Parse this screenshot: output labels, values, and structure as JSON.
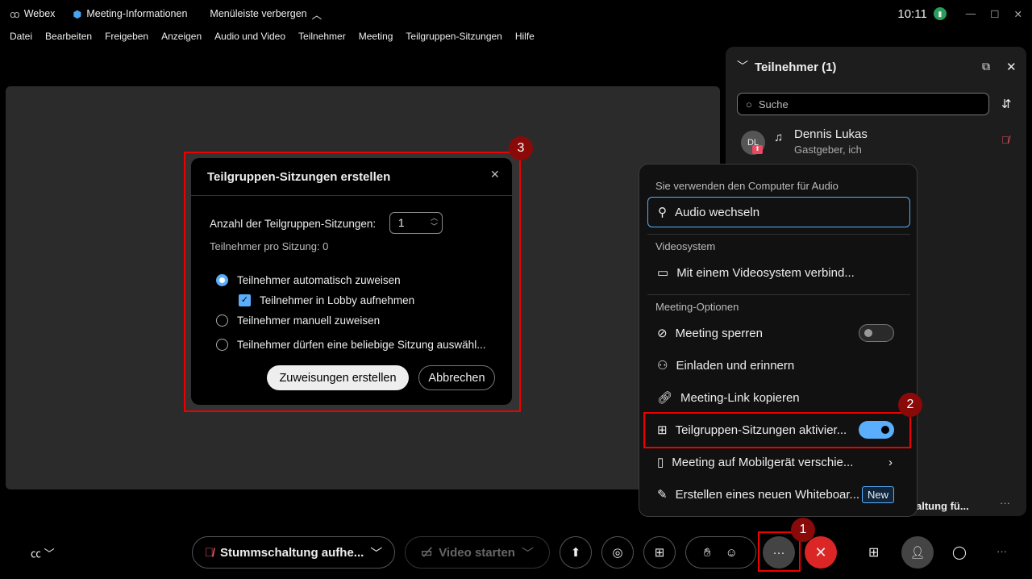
{
  "titlebar": {
    "app": "Webex",
    "meeting_info": "Meeting-Informationen",
    "hide_menu": "Menüleiste verbergen",
    "time": "10:11"
  },
  "menu": [
    "Datei",
    "Bearbeiten",
    "Freigeben",
    "Anzeigen",
    "Audio und Video",
    "Teilnehmer",
    "Meeting",
    "Teilgruppen-Sitzungen",
    "Hilfe"
  ],
  "panel": {
    "title": "Teilnehmer (1)",
    "search_placeholder": "Suche",
    "participant": {
      "initials": "DL",
      "name": "Dennis Lukas",
      "role": "Gastgeber, ich"
    },
    "truncated_text": "altung fü..."
  },
  "popup": {
    "audio_header": "Sie verwenden den Computer für Audio",
    "audio_switch": "Audio wechseln",
    "video_header": "Videosystem",
    "video_connect": "Mit einem Videosystem verbind...",
    "options_header": "Meeting-Optionen",
    "lock": "Meeting sperren",
    "lock_on": false,
    "invite": "Einladen und erinnern",
    "copy_link": "Meeting-Link kopieren",
    "breakout": "Teilgruppen-Sitzungen aktivier...",
    "breakout_on": true,
    "mobile": "Meeting auf Mobilgerät verschie...",
    "whiteboard": "Erstellen eines neuen Whiteboar...",
    "new_badge": "New"
  },
  "dialog": {
    "title": "Teilgruppen-Sitzungen erstellen",
    "count_label": "Anzahl der Teilgruppen-Sitzungen:",
    "count_value": "1",
    "per_session": "Teilnehmer pro Sitzung: 0",
    "opt_auto": "Teilnehmer automatisch zuweisen",
    "opt_lobby": "Teilnehmer in Lobby aufnehmen",
    "opt_manual": "Teilnehmer manuell zuweisen",
    "opt_free": "Teilnehmer dürfen eine beliebige Sitzung auswähl...",
    "selected": "auto",
    "lobby_checked": true,
    "create": "Zuweisungen erstellen",
    "cancel": "Abbrechen"
  },
  "toolbar": {
    "mute": "Stummschaltung aufhe...",
    "video": "Video starten",
    "more": "···"
  },
  "annotations": [
    "1",
    "2",
    "3"
  ],
  "colors": {
    "accent": "#5aaefc",
    "end_call": "#dc2626",
    "annotation": "#8a0a0a",
    "highlight": "#ee0000"
  }
}
